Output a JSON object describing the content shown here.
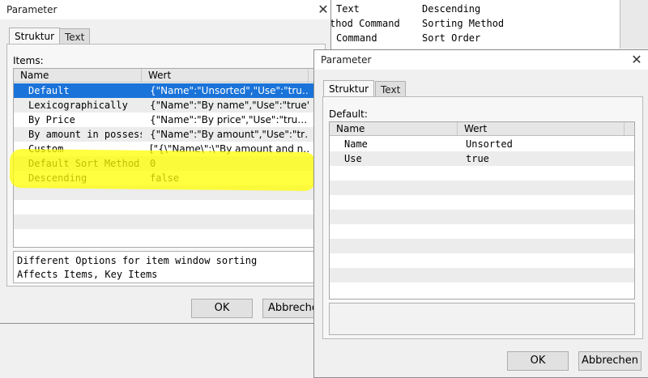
{
  "background_list": {
    "rows": [
      {
        "left": "Text",
        "right": "Descending"
      },
      {
        "left": "thod Command",
        "right": "Sorting Method"
      },
      {
        "left": "Command",
        "right": "Sort Order"
      }
    ]
  },
  "window1": {
    "title": "Parameter",
    "close_glyph": "✕",
    "tabs": {
      "struktur": "Struktur",
      "text": "Text"
    },
    "items_label": "Items:",
    "columns": {
      "name": "Name",
      "wert": "Wert"
    },
    "rows": [
      {
        "name": "Default",
        "value": "{\"Name\":\"Unsorted\",\"Use\":\"tru…"
      },
      {
        "name": "Lexicographically",
        "value": "{\"Name\":\"By name\",\"Use\":\"true\"}"
      },
      {
        "name": "By Price",
        "value": "{\"Name\":\"By price\",\"Use\":\"tru…"
      },
      {
        "name": "By amount in possess…",
        "value": "{\"Name\":\"By amount\",\"Use\":\"tr…"
      },
      {
        "name": "Custom",
        "value": "[\"{\\\"Name\\\":\\\"By amount and n…"
      },
      {
        "name": "Default Sort Method",
        "value": "0"
      },
      {
        "name": "Descending",
        "value": "false"
      }
    ],
    "description_line1": "Different Options for item window sorting",
    "description_line2": "Affects Items, Key Items",
    "ok_label": "OK",
    "cancel_label": "Abbrechen"
  },
  "window2": {
    "title": "Parameter",
    "close_glyph": "✕",
    "tabs": {
      "struktur": "Struktur",
      "text": "Text"
    },
    "default_label": "Default:",
    "columns": {
      "name": "Name",
      "wert": "Wert"
    },
    "rows": [
      {
        "name": "Name",
        "value": "Unsorted"
      },
      {
        "name": "Use",
        "value": "true"
      }
    ],
    "ok_label": "OK",
    "cancel_label": "Abbrechen"
  },
  "colors": {
    "selection": "#1a73d9",
    "highlight": "#ffff00"
  }
}
